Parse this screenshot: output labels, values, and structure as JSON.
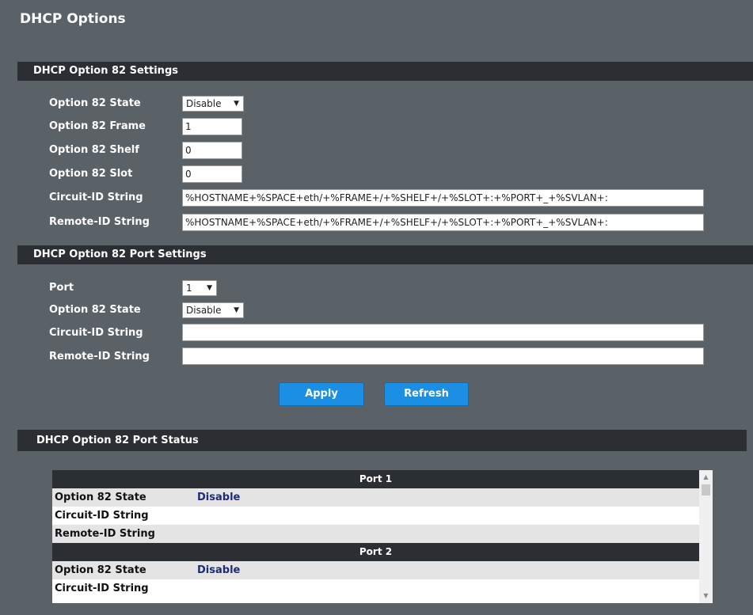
{
  "page_title": "DHCP Options",
  "settings": {
    "section_title": "DHCP Option 82 Settings",
    "state_label": "Option 82 State",
    "state_value": "Disable",
    "frame_label": "Option 82 Frame",
    "frame_value": "1",
    "shelf_label": "Option 82 Shelf",
    "shelf_value": "0",
    "slot_label": "Option 82 Slot",
    "slot_value": "0",
    "circuit_label": "Circuit-ID String",
    "circuit_value": "%HOSTNAME+%SPACE+eth/+%FRAME+/+%SHELF+/+%SLOT+:+%PORT+_+%SVLAN+:",
    "remote_label": "Remote-ID String",
    "remote_value": "%HOSTNAME+%SPACE+eth/+%FRAME+/+%SHELF+/+%SLOT+:+%PORT+_+%SVLAN+:"
  },
  "port_settings": {
    "section_title": "DHCP Option 82 Port Settings",
    "port_label": "Port",
    "port_value": "1",
    "state_label": "Option 82 State",
    "state_value": "Disable",
    "circuit_label": "Circuit-ID String",
    "circuit_value": "",
    "remote_label": "Remote-ID String",
    "remote_value": ""
  },
  "buttons": {
    "apply": "Apply",
    "refresh": "Refresh"
  },
  "status": {
    "section_title": "DHCP Option 82 Port Status",
    "port1": {
      "header": "Port 1",
      "state_label": "Option 82 State",
      "state_value": "Disable",
      "circuit_label": "Circuit-ID String",
      "remote_label": "Remote-ID String"
    },
    "port2": {
      "header": "Port 2",
      "state_label": "Option 82 State",
      "state_value": "Disable",
      "circuit_label": "Circuit-ID String"
    }
  },
  "icons": {
    "dropdown": "chevron-down-icon",
    "scroll_up": "scroll-up-arrow-icon",
    "scroll_down": "scroll-down-arrow-icon"
  },
  "colors": {
    "background": "#5a6167",
    "section_bar": "#2b2f33",
    "button": "#1a8fe3",
    "status_value": "#1f2a78"
  }
}
